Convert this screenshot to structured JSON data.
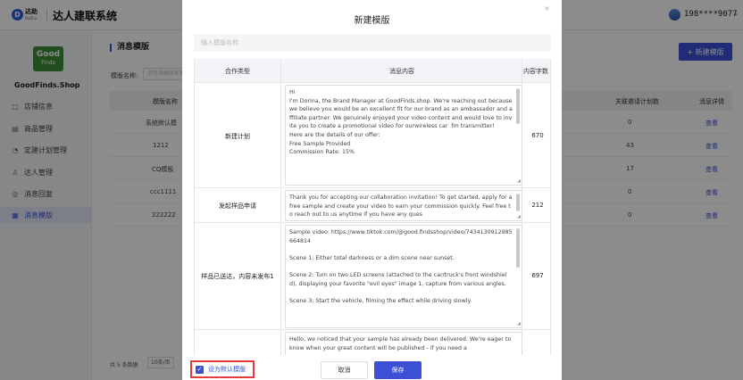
{
  "header": {
    "logo_mark": "D",
    "logo_text": "达助",
    "logo_sub": "DaZhu",
    "system_title": "达人建联系统",
    "user_phone": "198****9077",
    "user_caret": "⌄"
  },
  "sidebar": {
    "shop_logo_line1": "Good",
    "shop_logo_line2": "Finds",
    "shop_name": "GoodFinds.Shop",
    "shop_caret": "⌄",
    "items": [
      {
        "label": "店铺信息",
        "icon": "□"
      },
      {
        "label": "商品管理",
        "icon": "▤"
      },
      {
        "label": "定建计划管理",
        "icon": "◔"
      },
      {
        "label": "达人管理",
        "icon": "♙"
      },
      {
        "label": "消息回复",
        "icon": "◎"
      },
      {
        "label": "消息模版",
        "icon": "▦"
      }
    ]
  },
  "main": {
    "page_title": "消息模版",
    "filter_label": "模版名称:",
    "filter_placeholder": "请查询模版名称",
    "new_button": "+ 新建模版",
    "table": {
      "headers": [
        "模版名称",
        "关联邀请计划数",
        "消息详情"
      ],
      "rows": [
        {
          "name": "系统默认模",
          "count": "0",
          "link": "查看"
        },
        {
          "name": "1212",
          "count": "43",
          "link": "查看"
        },
        {
          "name": "CQ模板",
          "count": "17",
          "link": "查看"
        },
        {
          "name": "ccc1111",
          "count": "0",
          "link": "查看"
        },
        {
          "name": "222222",
          "count": "0",
          "link": "查看"
        }
      ]
    },
    "pager_text": "共 5 条数据",
    "pager_select": "10条/页"
  },
  "modal": {
    "title": "新建模版",
    "close": "×",
    "name_placeholder": "输入模版名称",
    "headers": {
      "type": "合作类型",
      "content": "消息内容",
      "count": "内容字数"
    },
    "rows": [
      {
        "type": "新建计划",
        "content": "Hi\nI'm Dorina, the Brand Manager at GoodFinds.shop. We're reaching out because we believe you would be an excellent fit for our brand as an ambassador and affiliate partner. We genuinely enjoyed your video content and would love to invite you to create a promotional video for ourwireless car  fm transmitter!\nHere are the details of our offer:\nFree Sample Provided\nCommission Rate: 15%",
        "count": "670"
      },
      {
        "type": "发起样品申请",
        "content": "Thank you for accepting our collaboration invitation! To get started, apply for a free sample and create your video to earn your commission quickly. Feel free to reach out to us anytime if you have any ques",
        "count": "212"
      },
      {
        "type": "样品已送达，内容未发布1",
        "content": "Sample video: https://www.tiktok.com/@good.findsshop/video/7434130912985664814\n\nScene 1: Either total darkness or a dim scene near sunset.\n\nScene 2: Turn on two LED screens (attached to the car/truck's front windshield), displaying your favorite \"evil eyes\" image 1, capture from various angles.\n\nScene 3: Start the vehicle, filming the effect while driving slowly.",
        "count": "697"
      },
      {
        "type": "",
        "content": "Hello, we noticed that your sample has already been delivered. We're eager to know when your great content will be published - if you need a",
        "count": ""
      }
    ],
    "default_checkbox": "设为默认模版",
    "cancel": "取消",
    "save": "保存"
  }
}
